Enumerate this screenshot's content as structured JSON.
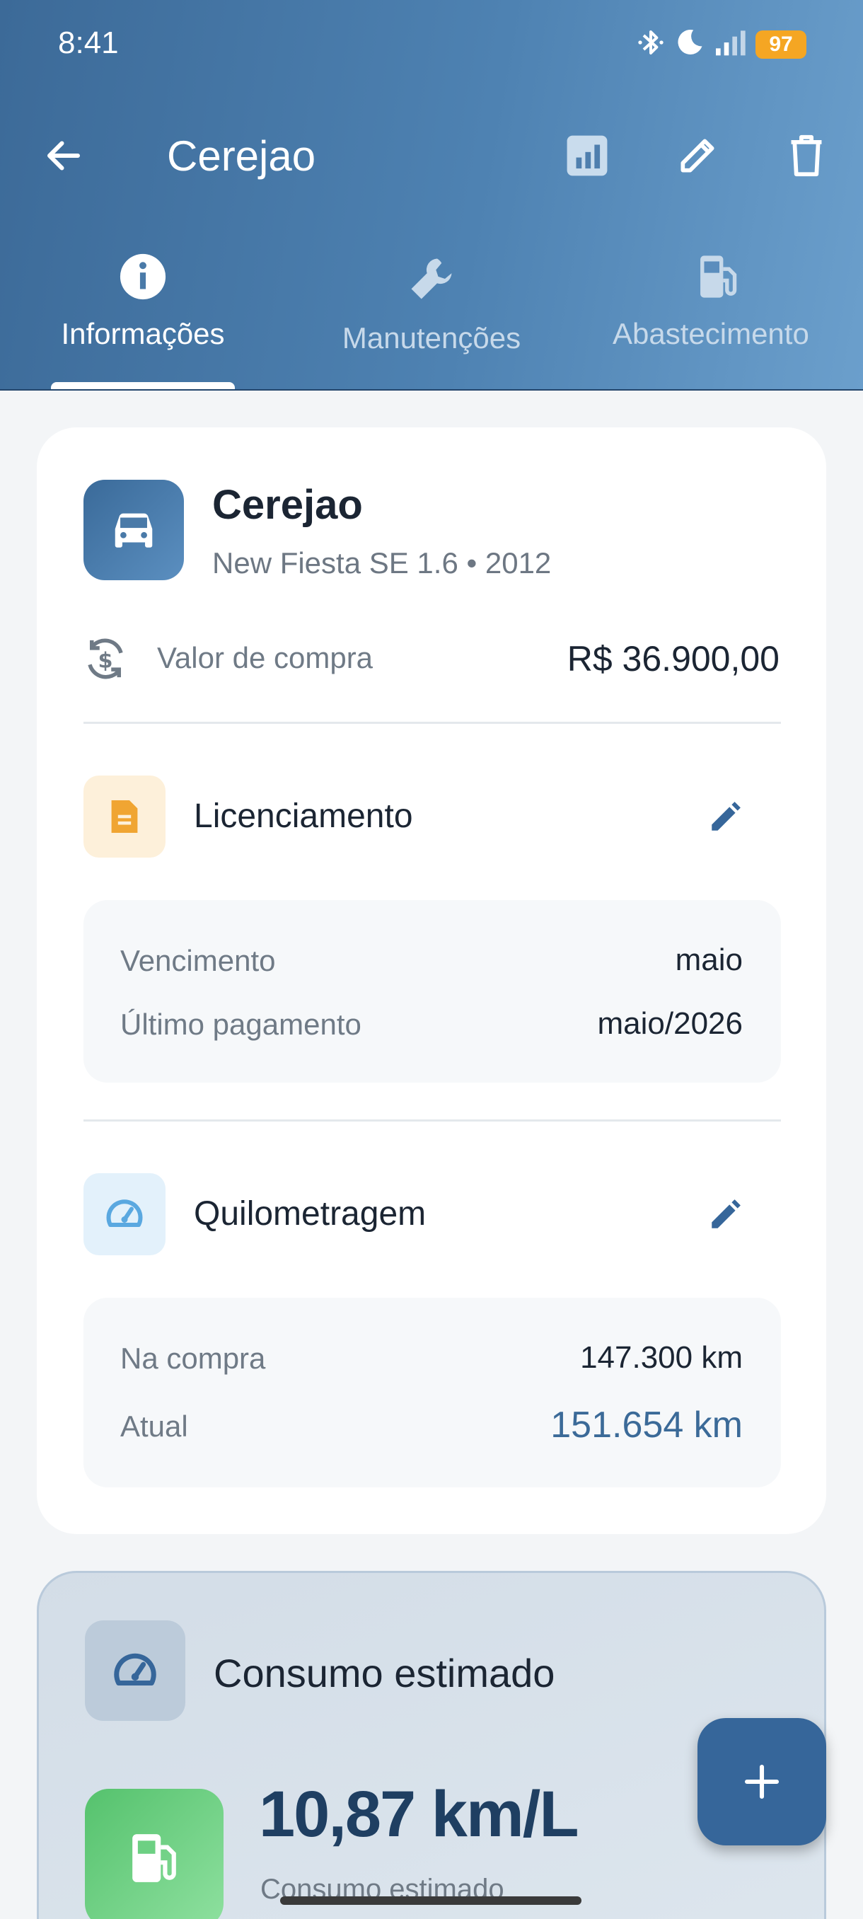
{
  "status_bar": {
    "time": "8:41",
    "battery": "97"
  },
  "header": {
    "title": "Cerejao"
  },
  "tabs": [
    {
      "label": "Informações",
      "icon": "info-icon",
      "active": true
    },
    {
      "label": "Manutenções",
      "icon": "wrench-icon",
      "active": false
    },
    {
      "label": "Abastecimento",
      "icon": "fuel-pump-icon",
      "active": false
    }
  ],
  "vehicle": {
    "name": "Cerejao",
    "model": "New Fiesta SE 1.6 • 2012",
    "purchase_label": "Valor de compra",
    "purchase_value": "R$ 36.900,00"
  },
  "licensing": {
    "title": "Licenciamento",
    "due_label": "Vencimento",
    "due_value": "maio",
    "last_payment_label": "Último pagamento",
    "last_payment_value": "maio/2026"
  },
  "mileage": {
    "title": "Quilometragem",
    "purchase_label": "Na compra",
    "purchase_value": "147.300 km",
    "current_label": "Atual",
    "current_value": "151.654 km"
  },
  "consumption": {
    "title": "Consumo estimado",
    "value": "10,87 km/L",
    "subtitle": "Consumo estimado"
  },
  "colors": {
    "header_gradient_start": "#3c6a98",
    "header_gradient_end": "#6b9fcc",
    "accent": "#36669a",
    "current_km": "#3b6a98",
    "license_bg": "#fdf0da",
    "license_icon": "#f0a532",
    "mileage_bg": "#e3f1fb",
    "mileage_icon": "#5aa8e0",
    "fuel_green": "#55c26d"
  }
}
